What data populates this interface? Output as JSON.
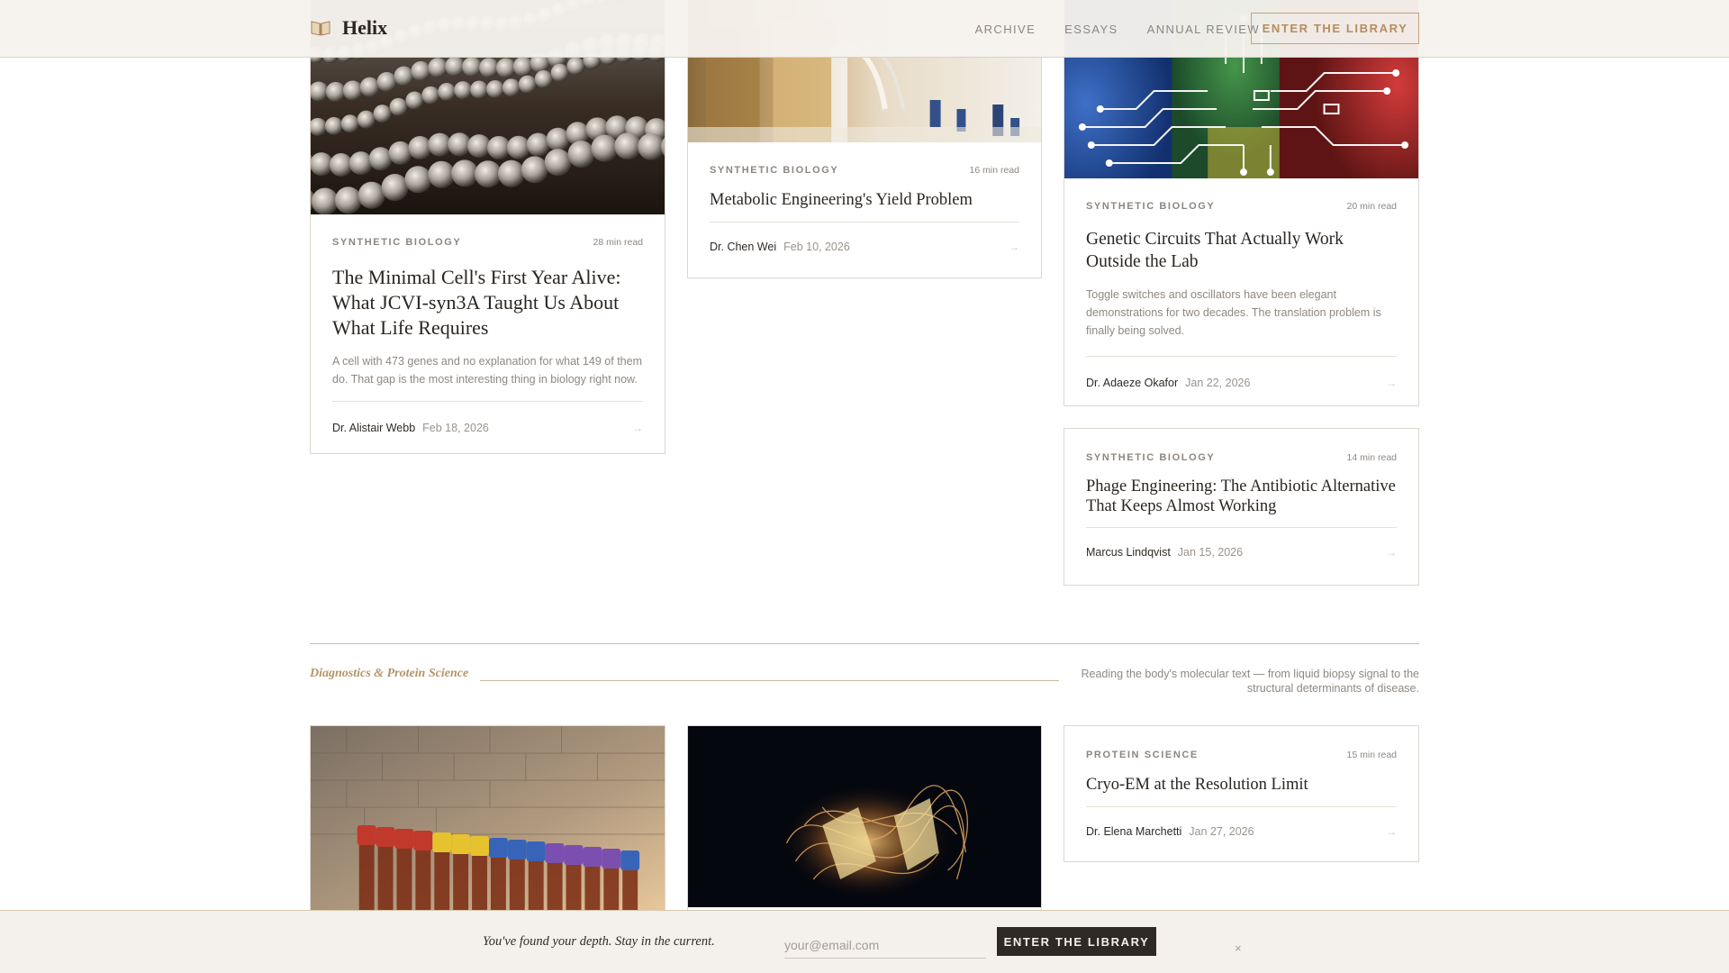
{
  "header": {
    "brand": "Helix",
    "nav": [
      "ARCHIVE",
      "ESSAYS",
      "ANNUAL REVIEW"
    ],
    "cta": "ENTER THE LIBRARY"
  },
  "cards": [
    {
      "category": "SYNTHETIC BIOLOGY",
      "read_time": "28 min read",
      "title": "The Minimal Cell's First Year Alive: What JCVI-syn3A Taught Us About What Life Requires",
      "excerpt": "A cell with 473 genes and no explanation for what 149 of them do. That gap is the most interesting thing in biology right now.",
      "author": "Dr. Alistair Webb",
      "date": "Feb 18, 2026",
      "arrow": "→"
    },
    {
      "category": "SYNTHETIC BIOLOGY",
      "read_time": "16 min read",
      "title": "Metabolic Engineering's Yield Problem",
      "author": "Dr. Chen Wei",
      "date": "Feb 10, 2026",
      "arrow": "→"
    },
    {
      "category": "SYNTHETIC BIOLOGY",
      "read_time": "20 min read",
      "title": "Genetic Circuits That Actually Work Outside the Lab",
      "excerpt": "Toggle switches and oscillators have been elegant demonstrations for two decades. The translation problem is finally being solved.",
      "author": "Dr. Adaeze Okafor",
      "date": "Jan 22, 2026",
      "arrow": "→"
    },
    {
      "category": "SYNTHETIC BIOLOGY",
      "read_time": "14 min read",
      "title": "Phage Engineering: The Antibiotic Alternative That Keeps Almost Working",
      "author": "Marcus Lindqvist",
      "date": "Jan 15, 2026",
      "arrow": "→"
    },
    {
      "category": "PROTEIN SCIENCE",
      "read_time": "15 min read",
      "title": "Cryo-EM at the Resolution Limit",
      "author": "Dr. Elena Marchetti",
      "date": "Jan 27, 2026",
      "arrow": "→"
    }
  ],
  "section": {
    "name": "Diagnostics & Protein Science",
    "description": "Reading the body's molecular text — from liquid biopsy signal to the structural determinants of disease."
  },
  "newsletter": {
    "text": "You've found your depth. Stay in the current.",
    "placeholder": "your@email.com",
    "button": "ENTER THE LIBRARY",
    "close": "×"
  },
  "colors": {
    "accent_gold": "#c5a477",
    "text_dark": "#2a2520",
    "muted": "#8f8882",
    "dark_button": "#2e2925",
    "header_bg": "#f6f3ee"
  },
  "icons": [
    "book-logo-icon",
    "arrow-right-icon",
    "close-icon"
  ]
}
